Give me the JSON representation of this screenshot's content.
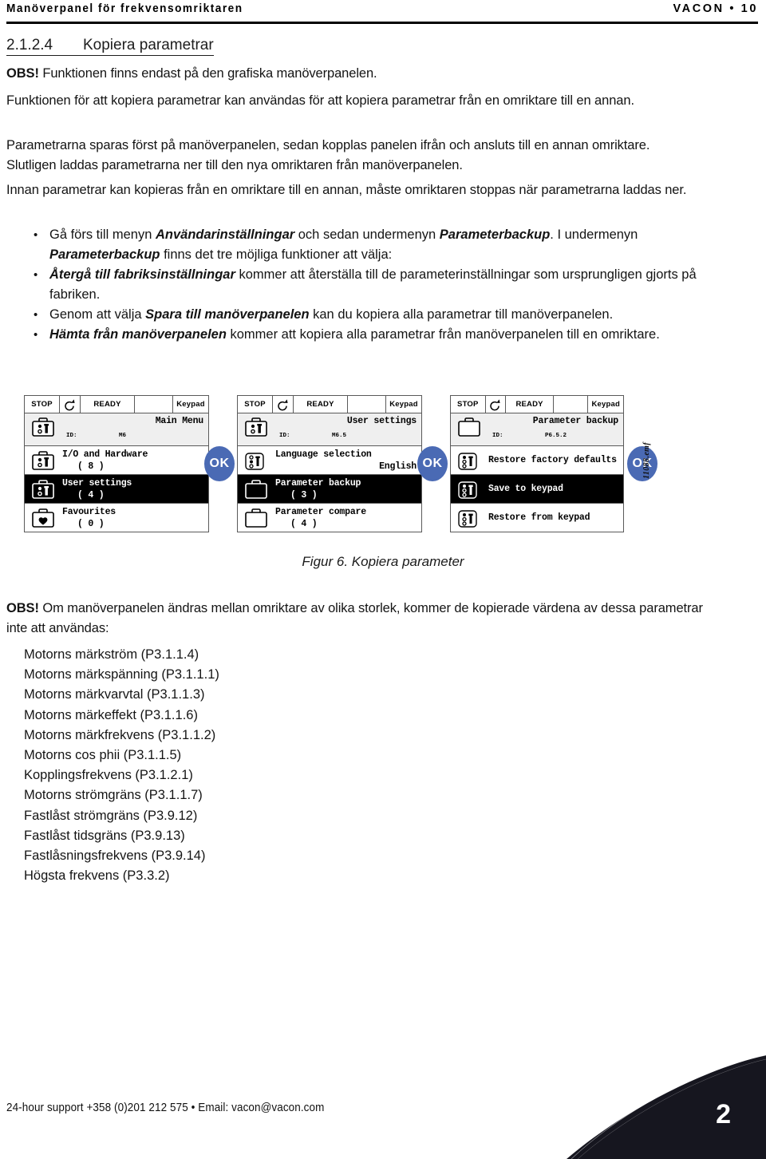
{
  "header": {
    "left": "Manöverpanel för frekvensomriktaren",
    "right": "VACON • 10"
  },
  "section": {
    "number": "2.1.2.4",
    "title": "Kopiera parametrar"
  },
  "paragraphs": {
    "note1_bold": "OBS!",
    "note1_rest": " Funktionen finns endast på den grafiska manöverpanelen.",
    "p1": "Funktionen för att kopiera parametrar kan användas för att kopiera parametrar från en omriktare till en annan.",
    "p2": "Parametrarna sparas först på manöverpanelen, sedan kopplas panelen ifrån och ansluts till en annan omriktare. Slutligen laddas parametrarna ner till den nya omriktaren från manöverpanelen.",
    "p3": "Innan parametrar kan kopieras från en omriktare till en annan, måste omriktaren stoppas när parametrarna laddas ner."
  },
  "bullets": [
    {
      "parts": [
        {
          "text": "Gå förs till menyn ",
          "style": "normal"
        },
        {
          "text": "Användarinställningar",
          "style": "italic"
        },
        {
          "text": " och sedan undermenyn ",
          "style": "normal"
        },
        {
          "text": "Parameterbackup",
          "style": "italic"
        },
        {
          "text": ". I undermenyn ",
          "style": "normal"
        },
        {
          "text": "Parameterbackup",
          "style": "italic"
        },
        {
          "text": " finns det tre möjliga funktioner att välja:",
          "style": "normal"
        }
      ]
    },
    {
      "parts": [
        {
          "text": "Återgå till fabriksinställningar",
          "style": "italic"
        },
        {
          "text": " kommer att återställa till de parameterinställningar som ursprungligen gjorts på fabriken.",
          "style": "normal"
        }
      ]
    },
    {
      "parts": [
        {
          "text": "Genom att välja ",
          "style": "normal"
        },
        {
          "text": "Spara till manöverpanelen",
          "style": "italic"
        },
        {
          "text": " kan du kopiera alla parametrar till manöverpanelen.",
          "style": "normal"
        }
      ]
    },
    {
      "parts": [
        {
          "text": "Hämta från manöverpanelen",
          "style": "italic"
        },
        {
          "text": " kommer att kopiera alla parametrar från manöverpanelen till en omriktare.",
          "style": "normal"
        }
      ]
    }
  ],
  "figure": {
    "caption": "Figur 6. Kopiera parameter",
    "source_label": "11088.emf",
    "ok_label": "OK",
    "statusbar": {
      "stop": "STOP",
      "rotate_icon": "rotate-arrow-icon",
      "ready": "READY",
      "blank": "",
      "keypad": "Keypad"
    },
    "panels": [
      {
        "title": "Main Menu",
        "id_label": "ID:",
        "id_value": "M6",
        "title_icon": "toolbox-params-icon",
        "rows": [
          {
            "icon": "toolbox-params-icon",
            "label": "I/O and Hardware",
            "sub": "( 8 )",
            "selected": false
          },
          {
            "icon": "toolbox-params-icon",
            "label": "User settings",
            "sub": "( 4 )",
            "selected": true
          },
          {
            "icon": "toolbox-heart-icon",
            "label": "Favourites",
            "sub": "( 0 )",
            "selected": false
          }
        ]
      },
      {
        "title": "User settings",
        "id_label": "ID:",
        "id_value": "M6.5",
        "title_icon": "toolbox-params-icon",
        "rows": [
          {
            "icon": "toolbox-language-icon",
            "label": "Language selection",
            "sub_right": "English",
            "selected": false
          },
          {
            "icon": "toolbox-plain-icon",
            "label": "Parameter backup",
            "sub": "( 3 )",
            "selected": true
          },
          {
            "icon": "toolbox-plain-icon",
            "label": "Parameter compare",
            "sub": "( 4 )",
            "selected": false
          }
        ]
      },
      {
        "title": "Parameter backup",
        "id_label": "ID:",
        "id_value": "P6.5.2",
        "title_icon": "toolbox-plain-icon",
        "rows": [
          {
            "icon": "toolbox-params-icon",
            "label": "Restore factory defaults",
            "selected": false
          },
          {
            "icon": "toolbox-params-icon",
            "label": "Save to keypad",
            "selected": true
          },
          {
            "icon": "toolbox-params-icon",
            "label": "Restore from keypad",
            "selected": false
          }
        ]
      }
    ]
  },
  "note2": {
    "bold": "OBS!",
    "rest": " Om manöverpanelen ändras mellan omriktare av olika storlek, kommer de kopierade värdena av dessa parametrar inte att användas:"
  },
  "parameter_list": [
    "Motorns märkström (P3.1.1.4)",
    "Motorns märkspänning (P3.1.1.1)",
    "Motorns märkvarvtal (P3.1.1.3)",
    "Motorns märkeffekt (P3.1.1.6)",
    "Motorns märkfrekvens (P3.1.1.2)",
    "Motorns cos phii (P3.1.1.5)",
    "Kopplingsfrekvens (P3.1.2.1)",
    "Motorns strömgräns (P3.1.1.7)",
    "Fastlåst strömgräns (P3.9.12)",
    "Fastlåst tidsgräns (P3.9.13)",
    "Fastlåsningsfrekvens (P3.9.14)",
    "Högsta frekvens (P3.3.2)"
  ],
  "footer": {
    "support": "24-hour support +358 (0)201 212 575 • Email: vacon@vacon.com",
    "page_number": "2"
  },
  "colors": {
    "ok_button": "#4a6ab4",
    "selected_row": "#000000",
    "corner": "#16161f"
  }
}
